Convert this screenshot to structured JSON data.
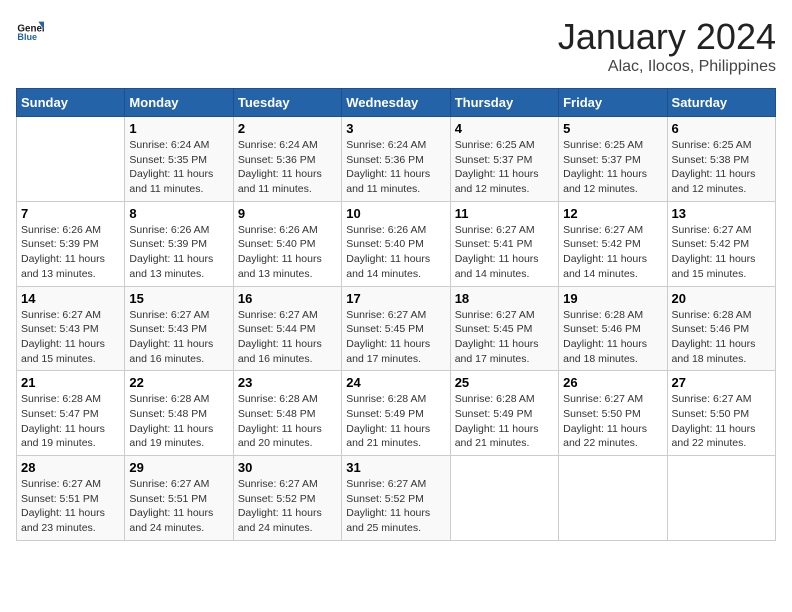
{
  "header": {
    "logo_line1": "General",
    "logo_line2": "Blue",
    "title": "January 2024",
    "subtitle": "Alac, Ilocos, Philippines"
  },
  "days_of_week": [
    "Sunday",
    "Monday",
    "Tuesday",
    "Wednesday",
    "Thursday",
    "Friday",
    "Saturday"
  ],
  "weeks": [
    [
      {
        "day": "",
        "info": ""
      },
      {
        "day": "1",
        "info": "Sunrise: 6:24 AM\nSunset: 5:35 PM\nDaylight: 11 hours\nand 11 minutes."
      },
      {
        "day": "2",
        "info": "Sunrise: 6:24 AM\nSunset: 5:36 PM\nDaylight: 11 hours\nand 11 minutes."
      },
      {
        "day": "3",
        "info": "Sunrise: 6:24 AM\nSunset: 5:36 PM\nDaylight: 11 hours\nand 11 minutes."
      },
      {
        "day": "4",
        "info": "Sunrise: 6:25 AM\nSunset: 5:37 PM\nDaylight: 11 hours\nand 12 minutes."
      },
      {
        "day": "5",
        "info": "Sunrise: 6:25 AM\nSunset: 5:37 PM\nDaylight: 11 hours\nand 12 minutes."
      },
      {
        "day": "6",
        "info": "Sunrise: 6:25 AM\nSunset: 5:38 PM\nDaylight: 11 hours\nand 12 minutes."
      }
    ],
    [
      {
        "day": "7",
        "info": "Sunrise: 6:26 AM\nSunset: 5:39 PM\nDaylight: 11 hours\nand 13 minutes."
      },
      {
        "day": "8",
        "info": "Sunrise: 6:26 AM\nSunset: 5:39 PM\nDaylight: 11 hours\nand 13 minutes."
      },
      {
        "day": "9",
        "info": "Sunrise: 6:26 AM\nSunset: 5:40 PM\nDaylight: 11 hours\nand 13 minutes."
      },
      {
        "day": "10",
        "info": "Sunrise: 6:26 AM\nSunset: 5:40 PM\nDaylight: 11 hours\nand 14 minutes."
      },
      {
        "day": "11",
        "info": "Sunrise: 6:27 AM\nSunset: 5:41 PM\nDaylight: 11 hours\nand 14 minutes."
      },
      {
        "day": "12",
        "info": "Sunrise: 6:27 AM\nSunset: 5:42 PM\nDaylight: 11 hours\nand 14 minutes."
      },
      {
        "day": "13",
        "info": "Sunrise: 6:27 AM\nSunset: 5:42 PM\nDaylight: 11 hours\nand 15 minutes."
      }
    ],
    [
      {
        "day": "14",
        "info": "Sunrise: 6:27 AM\nSunset: 5:43 PM\nDaylight: 11 hours\nand 15 minutes."
      },
      {
        "day": "15",
        "info": "Sunrise: 6:27 AM\nSunset: 5:43 PM\nDaylight: 11 hours\nand 16 minutes."
      },
      {
        "day": "16",
        "info": "Sunrise: 6:27 AM\nSunset: 5:44 PM\nDaylight: 11 hours\nand 16 minutes."
      },
      {
        "day": "17",
        "info": "Sunrise: 6:27 AM\nSunset: 5:45 PM\nDaylight: 11 hours\nand 17 minutes."
      },
      {
        "day": "18",
        "info": "Sunrise: 6:27 AM\nSunset: 5:45 PM\nDaylight: 11 hours\nand 17 minutes."
      },
      {
        "day": "19",
        "info": "Sunrise: 6:28 AM\nSunset: 5:46 PM\nDaylight: 11 hours\nand 18 minutes."
      },
      {
        "day": "20",
        "info": "Sunrise: 6:28 AM\nSunset: 5:46 PM\nDaylight: 11 hours\nand 18 minutes."
      }
    ],
    [
      {
        "day": "21",
        "info": "Sunrise: 6:28 AM\nSunset: 5:47 PM\nDaylight: 11 hours\nand 19 minutes."
      },
      {
        "day": "22",
        "info": "Sunrise: 6:28 AM\nSunset: 5:48 PM\nDaylight: 11 hours\nand 19 minutes."
      },
      {
        "day": "23",
        "info": "Sunrise: 6:28 AM\nSunset: 5:48 PM\nDaylight: 11 hours\nand 20 minutes."
      },
      {
        "day": "24",
        "info": "Sunrise: 6:28 AM\nSunset: 5:49 PM\nDaylight: 11 hours\nand 21 minutes."
      },
      {
        "day": "25",
        "info": "Sunrise: 6:28 AM\nSunset: 5:49 PM\nDaylight: 11 hours\nand 21 minutes."
      },
      {
        "day": "26",
        "info": "Sunrise: 6:27 AM\nSunset: 5:50 PM\nDaylight: 11 hours\nand 22 minutes."
      },
      {
        "day": "27",
        "info": "Sunrise: 6:27 AM\nSunset: 5:50 PM\nDaylight: 11 hours\nand 22 minutes."
      }
    ],
    [
      {
        "day": "28",
        "info": "Sunrise: 6:27 AM\nSunset: 5:51 PM\nDaylight: 11 hours\nand 23 minutes."
      },
      {
        "day": "29",
        "info": "Sunrise: 6:27 AM\nSunset: 5:51 PM\nDaylight: 11 hours\nand 24 minutes."
      },
      {
        "day": "30",
        "info": "Sunrise: 6:27 AM\nSunset: 5:52 PM\nDaylight: 11 hours\nand 24 minutes."
      },
      {
        "day": "31",
        "info": "Sunrise: 6:27 AM\nSunset: 5:52 PM\nDaylight: 11 hours\nand 25 minutes."
      },
      {
        "day": "",
        "info": ""
      },
      {
        "day": "",
        "info": ""
      },
      {
        "day": "",
        "info": ""
      }
    ]
  ]
}
